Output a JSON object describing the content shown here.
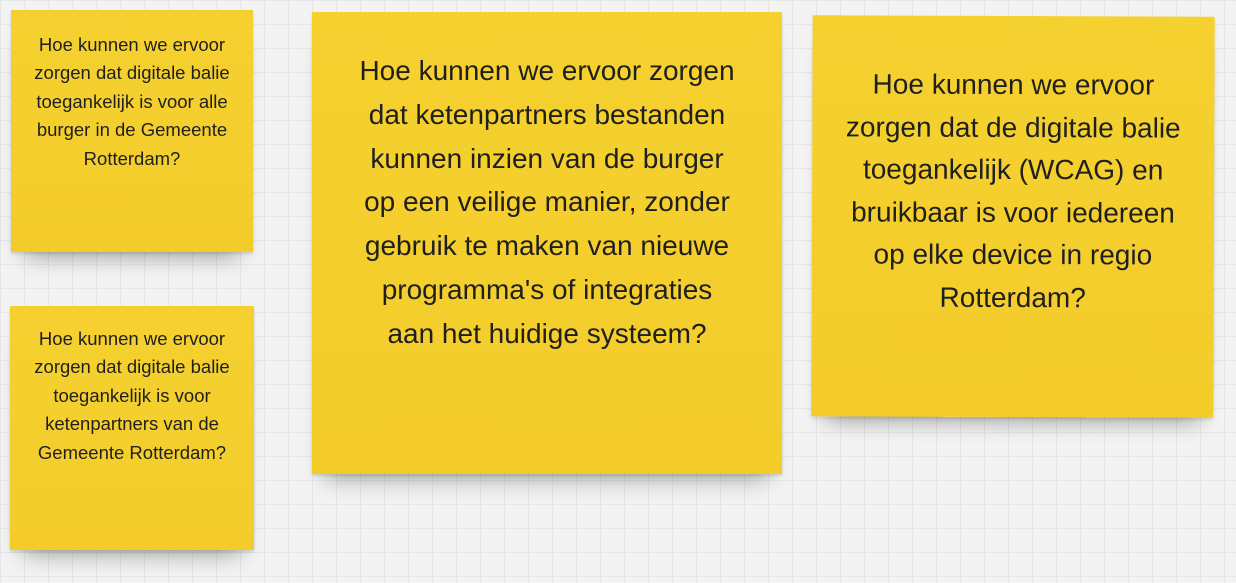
{
  "canvas": {
    "background_color": "#f3f3f3",
    "grid_color": "#e6e6e6"
  },
  "notes": [
    {
      "color": "#f5d130",
      "text": "Hoe kunnen we ervoor zorgen dat digitale balie toegankelijk is voor alle burger in de Gemeente Rotterdam?"
    },
    {
      "color": "#f5d130",
      "text": "Hoe kunnen we ervoor zorgen dat digitale balie toegankelijk is voor ketenpartners van de Gemeente Rotterdam?"
    },
    {
      "color": "#f5d130",
      "text": "Hoe kunnen we ervoor zorgen dat ketenpartners bestanden kunnen inzien van de burger op een veilige manier, zonder gebruik te maken van nieuwe programma's of integraties aan het huidige systeem?"
    },
    {
      "color": "#f5d130",
      "text": "Hoe kunnen we ervoor zorgen dat de digitale balie toegankelijk (WCAG) en bruikbaar is voor iedereen op elke device in regio Rotterdam?"
    }
  ]
}
